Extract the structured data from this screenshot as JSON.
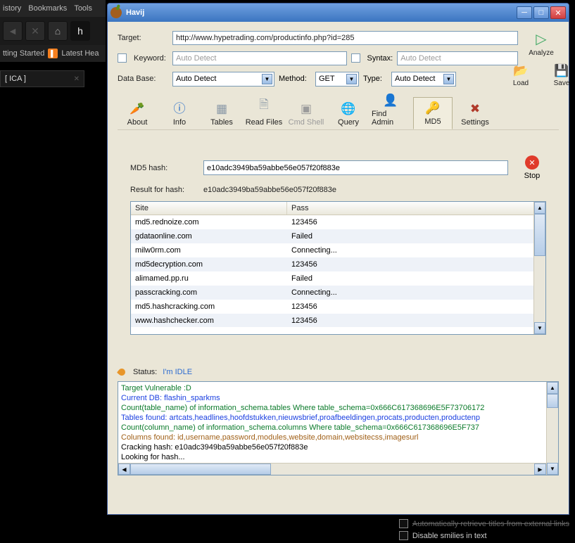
{
  "browser": {
    "menu": [
      "istory",
      "Bookmarks",
      "Tools"
    ],
    "bookmark_label1": "tting Started",
    "bookmark_label2": "Latest Hea",
    "tab": "[ ICA ]",
    "site_icon": "h"
  },
  "window": {
    "title": "Havij"
  },
  "form": {
    "target_lbl": "Target:",
    "target_val": "http://www.hypetrading.com/productinfo.php?id=285",
    "keyword_lbl": "Keyword:",
    "keyword_ph": "Auto Detect",
    "syntax_lbl": "Syntax:",
    "syntax_ph": "Auto Detect",
    "db_lbl": "Data Base:",
    "db_val": "Auto Detect",
    "method_lbl": "Method:",
    "method_val": "GET",
    "type_lbl": "Type:",
    "type_val": "Auto Detect",
    "analyze": "Analyze",
    "load": "Load",
    "save": "Save"
  },
  "toolbar": {
    "about": "About",
    "info": "Info",
    "tables": "Tables",
    "readfiles": "Read Files",
    "cmdshell": "Cmd Shell",
    "query": "Query",
    "findadmin": "Find Admin",
    "md5": "MD5",
    "settings": "Settings"
  },
  "md5": {
    "hash_lbl": "MD5 hash:",
    "hash_val": "e10adc3949ba59abbe56e057f20f883e",
    "stop": "Stop",
    "result_lbl": "Result for hash:",
    "result_val": "e10adc3949ba59abbe56e057f20f883e",
    "cols": {
      "site": "Site",
      "pass": "Pass"
    },
    "rows": [
      {
        "site": "md5.rednoize.com",
        "pass": "123456"
      },
      {
        "site": "gdataonline.com",
        "pass": "Failed"
      },
      {
        "site": "milw0rm.com",
        "pass": "Connecting..."
      },
      {
        "site": "md5decryption.com",
        "pass": "123456"
      },
      {
        "site": "alimamed.pp.ru",
        "pass": "Failed"
      },
      {
        "site": "passcracking.com",
        "pass": "Connecting..."
      },
      {
        "site": "md5.hashcracking.com",
        "pass": "123456"
      },
      {
        "site": "www.hashchecker.com",
        "pass": "123456"
      }
    ]
  },
  "status": {
    "lbl": "Status:",
    "val": "I'm IDLE"
  },
  "log": {
    "lines": [
      {
        "cls": "lg-green",
        "t": "Target Vulnerable :D"
      },
      {
        "cls": "lg-blue",
        "t": "Current DB: flashin_sparkms"
      },
      {
        "cls": "lg-green",
        "t": "Count(table_name) of information_schema.tables Where table_schema=0x666C617368696E5F73706172"
      },
      {
        "cls": "lg-blue",
        "t": "Tables found: artcats,headlines,hoofdstukken,nieuwsbrief,proafbeeldingen,procats,producten,productenp"
      },
      {
        "cls": "lg-green",
        "t": "Count(column_name) of information_schema.columns Where table_schema=0x666C617368696E5F737"
      },
      {
        "cls": "lg-brown",
        "t": "Columns found: id,username,password,modules,website,domain,websitecss,imagesurl"
      },
      {
        "cls": "lg-black",
        "t": "Cracking hash: e10adc3949ba59abbe56e057f20f883e"
      },
      {
        "cls": "lg-black",
        "t": "Looking for hash..."
      }
    ]
  },
  "footer": {
    "opt1": "Automatically retrieve titles from external links",
    "opt2": "Disable smilies in text"
  }
}
